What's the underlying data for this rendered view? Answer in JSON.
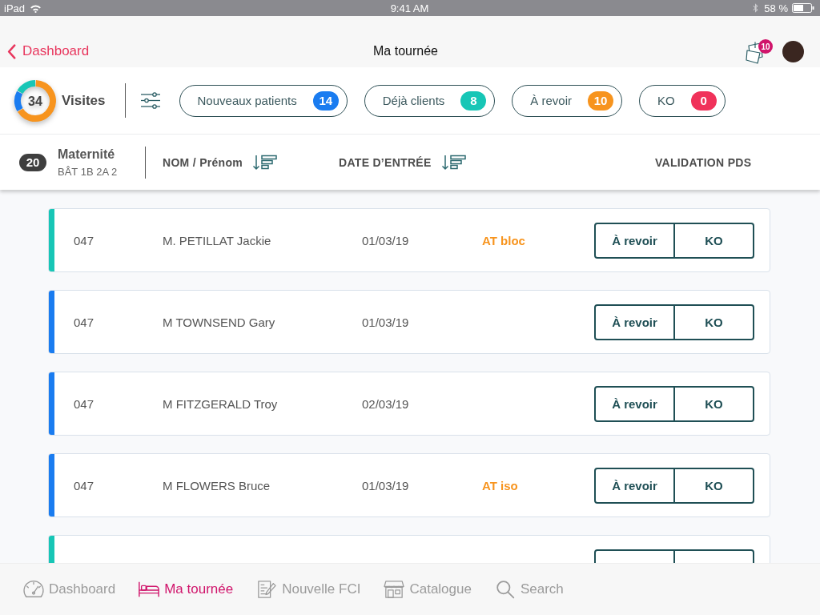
{
  "status_bar": {
    "device": "iPad",
    "time": "9:41 AM",
    "battery": "58 %"
  },
  "nav_bar": {
    "back": "Dashboard",
    "title": "Ma tournée",
    "notes_badge": "10"
  },
  "summary": {
    "visits_count": "34",
    "visits_label": "Visites",
    "filters": [
      {
        "label": "Nouveaux patients",
        "count": "14",
        "color": "#1a7cf0"
      },
      {
        "label": "Déjà clients",
        "count": "8",
        "color": "#17c6b6"
      },
      {
        "label": "À revoir",
        "count": "10",
        "color": "#f7941e"
      },
      {
        "label": "KO",
        "count": "0",
        "color": "#f0325a"
      }
    ]
  },
  "ward": {
    "count": "20",
    "name": "Maternité",
    "building": "BÂT 1B 2A 2"
  },
  "columns": [
    {
      "label": "NOM / Prénom",
      "sortable": true
    },
    {
      "label": "DATE D’ENTRÉE",
      "sortable": true
    },
    {
      "label": "VALIDATION PDS",
      "sortable": false
    }
  ],
  "patients": [
    {
      "room": "047",
      "name": "M. PETILLAT Jackie",
      "date": "01/03/19",
      "status": "AT bloc",
      "color": "#17c6b6",
      "actions": [
        "À revoir",
        "KO"
      ]
    },
    {
      "room": "047",
      "name": "M TOWNSEND Gary",
      "date": "01/03/19",
      "color": "#1a7cf0",
      "actions": [
        "À revoir",
        "KO"
      ]
    },
    {
      "room": "047",
      "name": "M FITZGERALD Troy",
      "date": "02/03/19",
      "color": "#1a7cf0",
      "actions": [
        "À revoir",
        "KO"
      ]
    },
    {
      "room": "047",
      "name": "M FLOWERS Bruce",
      "date": "01/03/19",
      "status": "AT iso",
      "color": "#1a7cf0",
      "actions": [
        "À revoir",
        "KO"
      ]
    }
  ],
  "partial_patient": {
    "color": "#17c6b6"
  },
  "tab_bar": [
    {
      "label": "Dashboard",
      "selected": false
    },
    {
      "label": "Ma tournée",
      "selected": true
    },
    {
      "label": "Nouvelle FCI",
      "selected": false
    },
    {
      "label": "Catalogue",
      "selected": false
    },
    {
      "label": "Search",
      "selected": false
    }
  ]
}
